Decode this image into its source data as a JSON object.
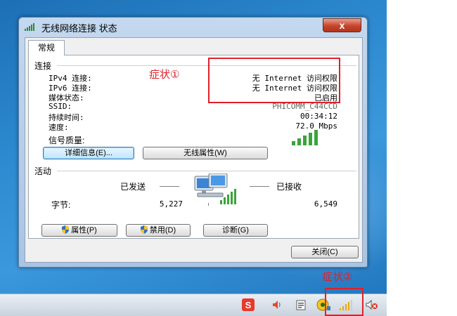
{
  "window": {
    "title": "无线网络连接 状态",
    "close_symbol": "x",
    "tab": "常规"
  },
  "connection": {
    "section": "连接",
    "rows": [
      {
        "label": "IPv4 连接:",
        "value": "无 Internet 访问权限"
      },
      {
        "label": "IPv6 连接:",
        "value": "无 Internet 访问权限"
      },
      {
        "label": "媒体状态:",
        "value": "已启用"
      },
      {
        "label": "SSID:",
        "value": "PHICOMM_C44CCD"
      },
      {
        "label": "持续时间:",
        "value": "00:34:12"
      },
      {
        "label": "速度:",
        "value": "72.0 Mbps"
      }
    ],
    "signal_label": "信号质量:",
    "signal_bars": 5,
    "details_button": "详细信息(E)...",
    "wireless_props_button": "无线属性(W)"
  },
  "activity": {
    "section": "活动",
    "sent_label": "已发送",
    "received_label": "已接收",
    "bytes_label": "字节:",
    "bytes_sent": "5,227",
    "bytes_received": "6,549"
  },
  "buttons": {
    "properties": "属性(P)",
    "disable": "禁用(D)",
    "diagnose": "诊断(G)",
    "close": "关闭(C)"
  },
  "annotations": {
    "symptom1": "症状①",
    "symptom2": "症状②",
    "highlight_color": "#e0202a"
  },
  "taskbar": {
    "tray_icons": [
      "sogou-input-icon",
      "speaker-icon",
      "clipboard-icon",
      "security-icon",
      "wifi-signal-icon",
      "speaker-muted-icon"
    ]
  }
}
